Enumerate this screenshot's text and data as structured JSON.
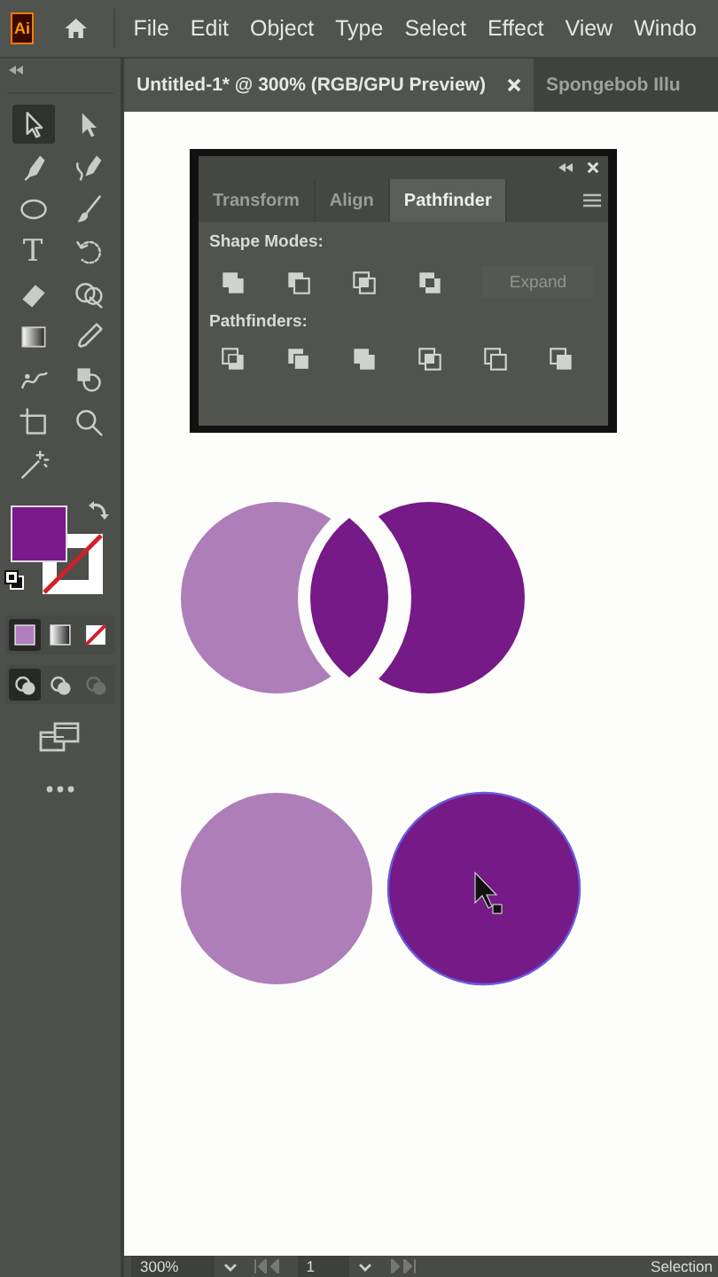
{
  "app_logo": "Ai",
  "menu": [
    "File",
    "Edit",
    "Object",
    "Type",
    "Select",
    "Effect",
    "View",
    "Windo"
  ],
  "tabs": [
    {
      "label": "Untitled-1* @ 300% (RGB/GPU Preview)",
      "selected": true,
      "closable": true
    },
    {
      "label": "Spongebob Illu",
      "selected": false,
      "closable": false
    }
  ],
  "tools": [
    {
      "selected": true
    },
    {
      "selected": false
    },
    {
      "selected": false
    },
    {
      "selected": false
    },
    {
      "selected": false
    },
    {
      "selected": false
    },
    {
      "selected": false,
      "label": "T"
    },
    {
      "selected": false
    },
    {
      "selected": false
    },
    {
      "selected": false
    },
    {
      "selected": false
    },
    {
      "selected": false
    },
    {
      "selected": false
    },
    {
      "selected": false
    },
    {
      "selected": false
    },
    {
      "selected": false
    },
    {
      "selected": false
    }
  ],
  "color_modes": [
    {
      "selected": true
    },
    {
      "selected": false
    },
    {
      "selected": false
    }
  ],
  "draw_modes": [
    {
      "selected": true,
      "disabled": false
    },
    {
      "selected": false,
      "disabled": false
    },
    {
      "selected": false,
      "disabled": true
    }
  ],
  "panel": {
    "tabs": [
      {
        "label": "Transform",
        "selected": false
      },
      {
        "label": "Align",
        "selected": false
      },
      {
        "label": "Pathfinder",
        "selected": true
      }
    ],
    "sections": [
      {
        "title": "Shape Modes:",
        "action": {
          "label": "Expand",
          "disabled": true
        }
      },
      {
        "title": "Pathfinders:"
      }
    ]
  },
  "status_bar": {
    "zoom": "300%",
    "page": "1",
    "mode": "Selection"
  }
}
